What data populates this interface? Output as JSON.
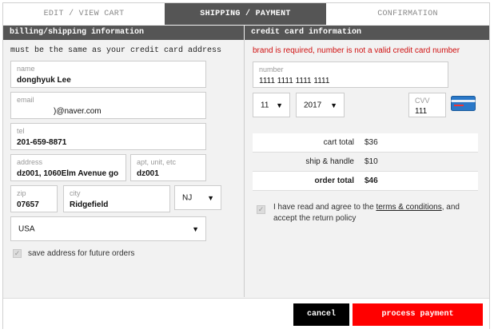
{
  "tabs": [
    {
      "label": "EDIT / VIEW CART"
    },
    {
      "label": "SHIPPING / PAYMENT"
    },
    {
      "label": "CONFIRMATION"
    }
  ],
  "billing": {
    "heading": "billing/shipping information",
    "note": "must be the same as your credit card address",
    "name": {
      "label": "name",
      "value": "donghyuk Lee"
    },
    "email": {
      "label": "email",
      "value": ")@naver.com"
    },
    "tel": {
      "label": "tel",
      "value": "201-659-8871"
    },
    "address": {
      "label": "address",
      "value": "dz001, 1060Elm Avenue go"
    },
    "apt": {
      "label": "apt, unit, etc",
      "value": "dz001"
    },
    "zip": {
      "label": "zip",
      "value": "07657"
    },
    "city": {
      "label": "city",
      "value": "Ridgefield"
    },
    "state": {
      "value": "NJ",
      "arrow": "▼"
    },
    "country": {
      "value": "USA",
      "arrow": "▼"
    },
    "save_label": "save address for future orders",
    "check_mark": "✓"
  },
  "card": {
    "heading": "credit card information",
    "error": "brand is required, number is not a valid credit card number",
    "number": {
      "label": "number",
      "value": "1111 1111 1111 1111"
    },
    "month": {
      "value": "11",
      "arrow": "▼"
    },
    "year": {
      "value": "2017",
      "arrow": "▼"
    },
    "cvv": {
      "label": "CVV",
      "value": "111"
    },
    "card_icon": "credit-card-icon",
    "totals": {
      "cart_label": "cart total",
      "cart_value": "$36",
      "ship_label": "ship & handle",
      "ship_value": "$10",
      "order_label": "order total",
      "order_value": "$46"
    },
    "agree_pre": "I have read and agree to the",
    "terms": "terms & conditions",
    "agree_post": ", and",
    "agree_line2": "accept the return policy"
  },
  "footer": {
    "cancel": "cancel",
    "process": "process payment"
  },
  "colors": {
    "accent": "#ff0000",
    "dark": "#555555",
    "error": "#d01010"
  }
}
